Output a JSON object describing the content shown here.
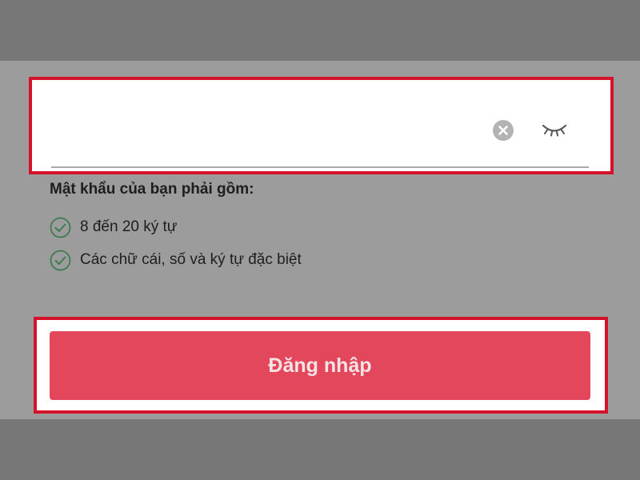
{
  "password_field": {
    "value": "",
    "clear_icon": "clear-circle-icon",
    "visibility_icon": "eye-closed-icon"
  },
  "requirements": {
    "title": "Mật khẩu của bạn phải gồm:",
    "items": [
      {
        "icon": "check-circle-icon",
        "label": "8 đến 20 ký tự",
        "satisfied": true
      },
      {
        "icon": "check-circle-icon",
        "label": "Các chữ cái, số và ký tự đặc biệt",
        "satisfied": true
      }
    ]
  },
  "login_button": {
    "label": "Đăng nhập"
  },
  "colors": {
    "highlight_border": "#d4122a",
    "button_background": "#e2475c",
    "check_color": "#3d7a52"
  }
}
